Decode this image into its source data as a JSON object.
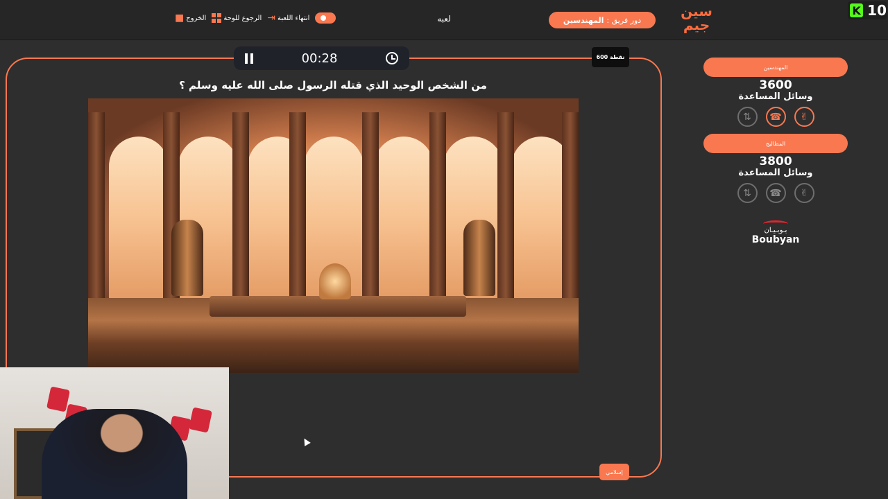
{
  "topbar": {
    "logo_text": "سين جيم",
    "turn_label": "دور فريق :",
    "turn_team": "المهندسين",
    "game_name": "لعبه",
    "actions": {
      "end_game": "انتهاء اللعبة",
      "back_to_board": "الرجوع للوحة",
      "exit": "الخروج"
    }
  },
  "kick": {
    "icon": "kick-logo",
    "viewers": "10"
  },
  "timer": {
    "time": "00:28"
  },
  "question": {
    "points": "600 نقطة",
    "text": "من الشخص الوحيد الذي قتله الرسول صلى الله عليه وسلم ؟",
    "category": "إسلامي"
  },
  "teams": [
    {
      "name": "المهندسين",
      "score": "3600",
      "helpers_label": "وسائل المساعدة",
      "helpers": [
        {
          "icon": "peace-hand-icon",
          "active": true
        },
        {
          "icon": "phone-icon",
          "active": true
        },
        {
          "icon": "switch-call-icon",
          "active": false
        }
      ]
    },
    {
      "name": "المطاليج",
      "score": "3800",
      "helpers_label": "وسائل المساعدة",
      "helpers": [
        {
          "icon": "peace-hand-icon",
          "active": false
        },
        {
          "icon": "phone-icon",
          "active": false
        },
        {
          "icon": "switch-call-icon",
          "active": false
        }
      ]
    }
  ],
  "sponsor": {
    "arabic": "بـوبـيـان",
    "english": "Boubyan"
  },
  "colors": {
    "accent": "#f97850",
    "background": "#2e2e2e",
    "topbar": "#262626"
  }
}
